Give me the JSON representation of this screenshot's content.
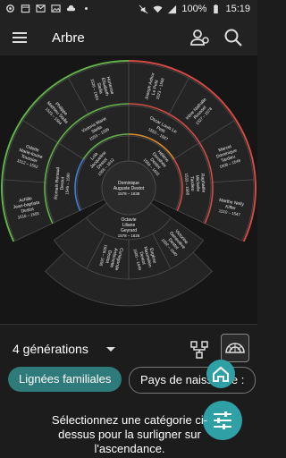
{
  "statusbar": {
    "battery": "100%",
    "time": "15:19"
  },
  "appbar": {
    "title": "Arbre"
  },
  "fan": {
    "root": {
      "name": "Dominique Auguste Destot",
      "years": "1578 – 1638"
    },
    "spouse": {
      "name": "Octavie Liliane Geyrard",
      "years": "1578 – 1626"
    },
    "gen2": [
      {
        "name": "Lola Jacqueline Destot",
        "years": "1555 – 1612"
      },
      {
        "name": "Hélène Dorothée Destot",
        "years": "1559 – 1602"
      }
    ],
    "gen3": [
      {
        "name": "Romain Renaud Destot",
        "years": "1545 – 1590"
      },
      {
        "name": "Victoria Marie Stella",
        "years": "1553 – 1595"
      },
      {
        "name": "Oscar Louis Le Petit",
        "years": "1553 – 1587"
      },
      {
        "name": "Raphaële Michelle Tardieu",
        "years": "1533 – 1568"
      }
    ],
    "gen4": [
      {
        "name": "Achille Jean-baptiste Destot",
        "years": "1510 – 1555"
      },
      {
        "name": "Odette Marie-louise Toussier",
        "years": "1512 – 1552"
      },
      {
        "name": "Philippe Mathieu Stella",
        "years": "1523 – 1564"
      },
      {
        "name": "Hortense Élisabeth Stella",
        "years": "1526 – 1584"
      },
      {
        "name": "Joseph Arthur Le Petit",
        "years": "1523 – 1568"
      },
      {
        "name": "Irène Nathalie Roussel",
        "years": "1527 – 1578"
      },
      {
        "name": "Marcel Dominique Tardieu",
        "years": "1508 – 1548"
      },
      {
        "name": "Marthe Nelly Kiffer",
        "years": "1510 – 1547"
      }
    ],
    "desc": [
      {
        "name": "Victorine Geneviève Destot",
        "years": "1602 – 1640"
      },
      {
        "name": "Eugène Maximilien Destot",
        "years": "1600 – 1649"
      },
      {
        "name": "Cunégonde Antoinette Destot",
        "years": "1606 – 1655"
      }
    ],
    "colors": {
      "green": "#63b14a",
      "blue": "#3f7fd8",
      "red": "#d64a45",
      "orange": "#e08c2a",
      "purple": "#8b53c7",
      "ring": "#4a4a4a",
      "fill": "#242424"
    }
  },
  "controls": {
    "generations": "4 générations"
  },
  "chips": {
    "active": "Lignées familiales",
    "inactive": "Pays de naissance :"
  },
  "message": "Sélectionnez une catégorie ci-dessus pour la surligner sur l'ascendance."
}
